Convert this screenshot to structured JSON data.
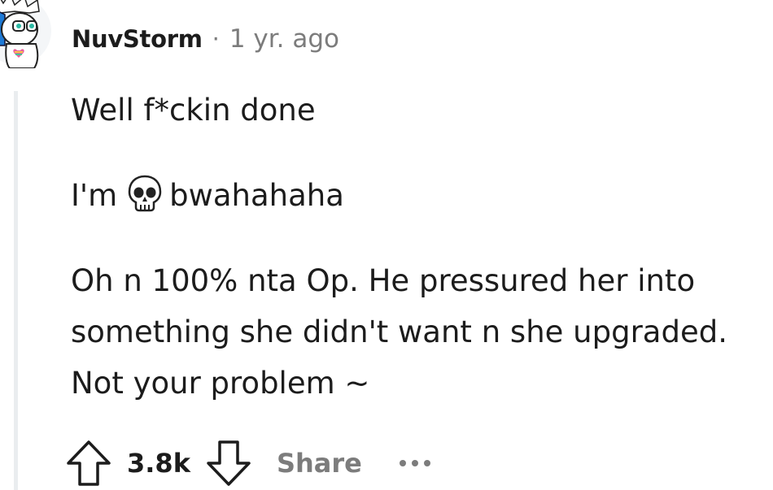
{
  "comment": {
    "author": "NuvStorm",
    "separator": "·",
    "timestamp": "1 yr. ago",
    "avatar_icon": "snoo-avatar-icon",
    "body": {
      "line1": "Well f*ckin done",
      "line2_before": "I'm",
      "line2_emoji": "skull-emoji",
      "line2_after": "bwahahaha",
      "line3": "Oh n 100% nta Op. He pressured her into",
      "line4": "something she didn't want n she upgraded.",
      "line5": "Not your problem ~"
    },
    "actions": {
      "upvote_icon": "upvote-arrow-icon",
      "score": "3.8k",
      "downvote_icon": "downvote-arrow-icon",
      "share_label": "Share",
      "more_icon": "more-options-icon"
    }
  },
  "colors": {
    "text": "#1c1c1c",
    "meta": "#7c7c7c",
    "thread_line": "#eaedef"
  }
}
